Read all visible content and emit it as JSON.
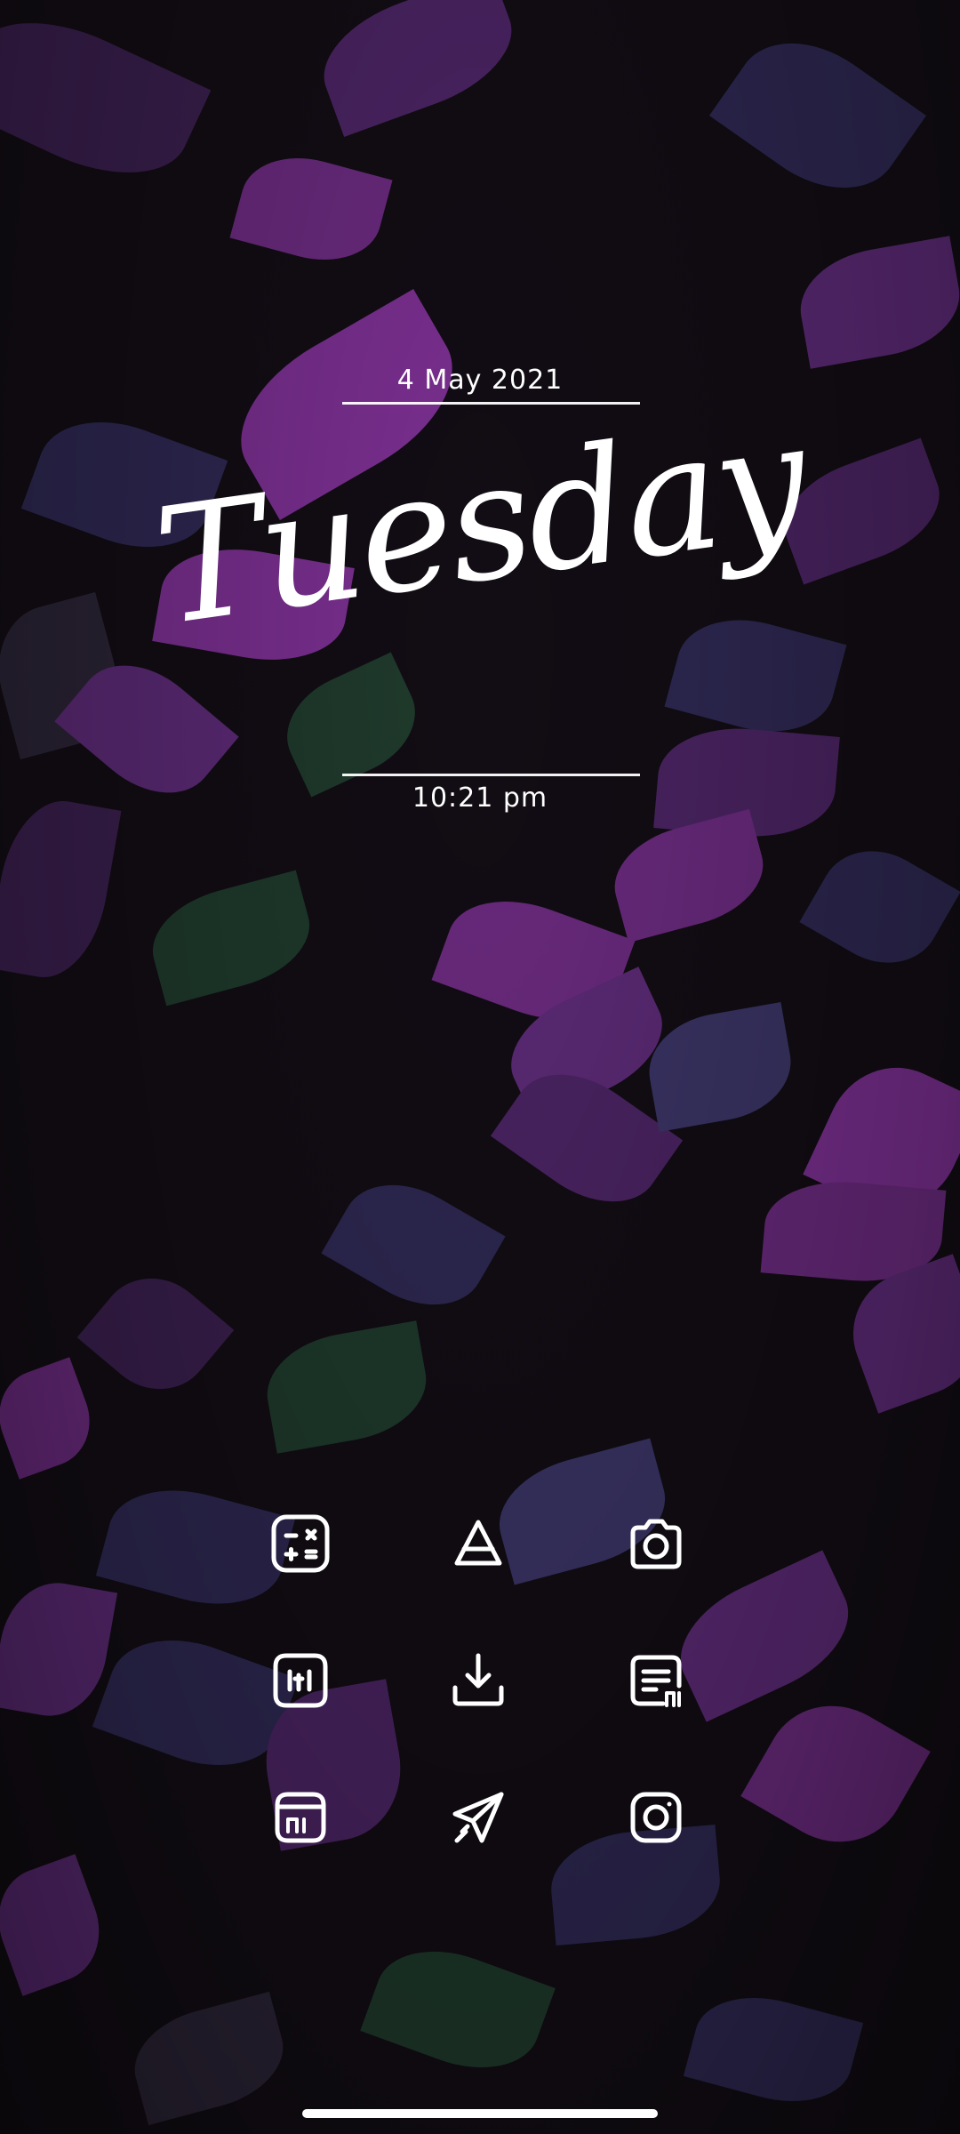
{
  "widget": {
    "date": "4 May 2021",
    "day": "Tuesday",
    "time": "10:21 pm"
  },
  "apps": [
    {
      "icon": "calculator-icon"
    },
    {
      "icon": "triangle-app-icon"
    },
    {
      "icon": "camera-icon"
    },
    {
      "icon": "screen-recorder-icon"
    },
    {
      "icon": "download-icon"
    },
    {
      "icon": "mi-notes-icon"
    },
    {
      "icon": "mi-file-manager-icon"
    },
    {
      "icon": "send-icon"
    },
    {
      "icon": "instagram-icon"
    }
  ],
  "colors": {
    "background": "#120d14",
    "leaf_purple": "#6a2a7e",
    "leaf_indigo": "#2e2852",
    "leaf_green": "#1f3a2c",
    "text": "#ffffff"
  }
}
